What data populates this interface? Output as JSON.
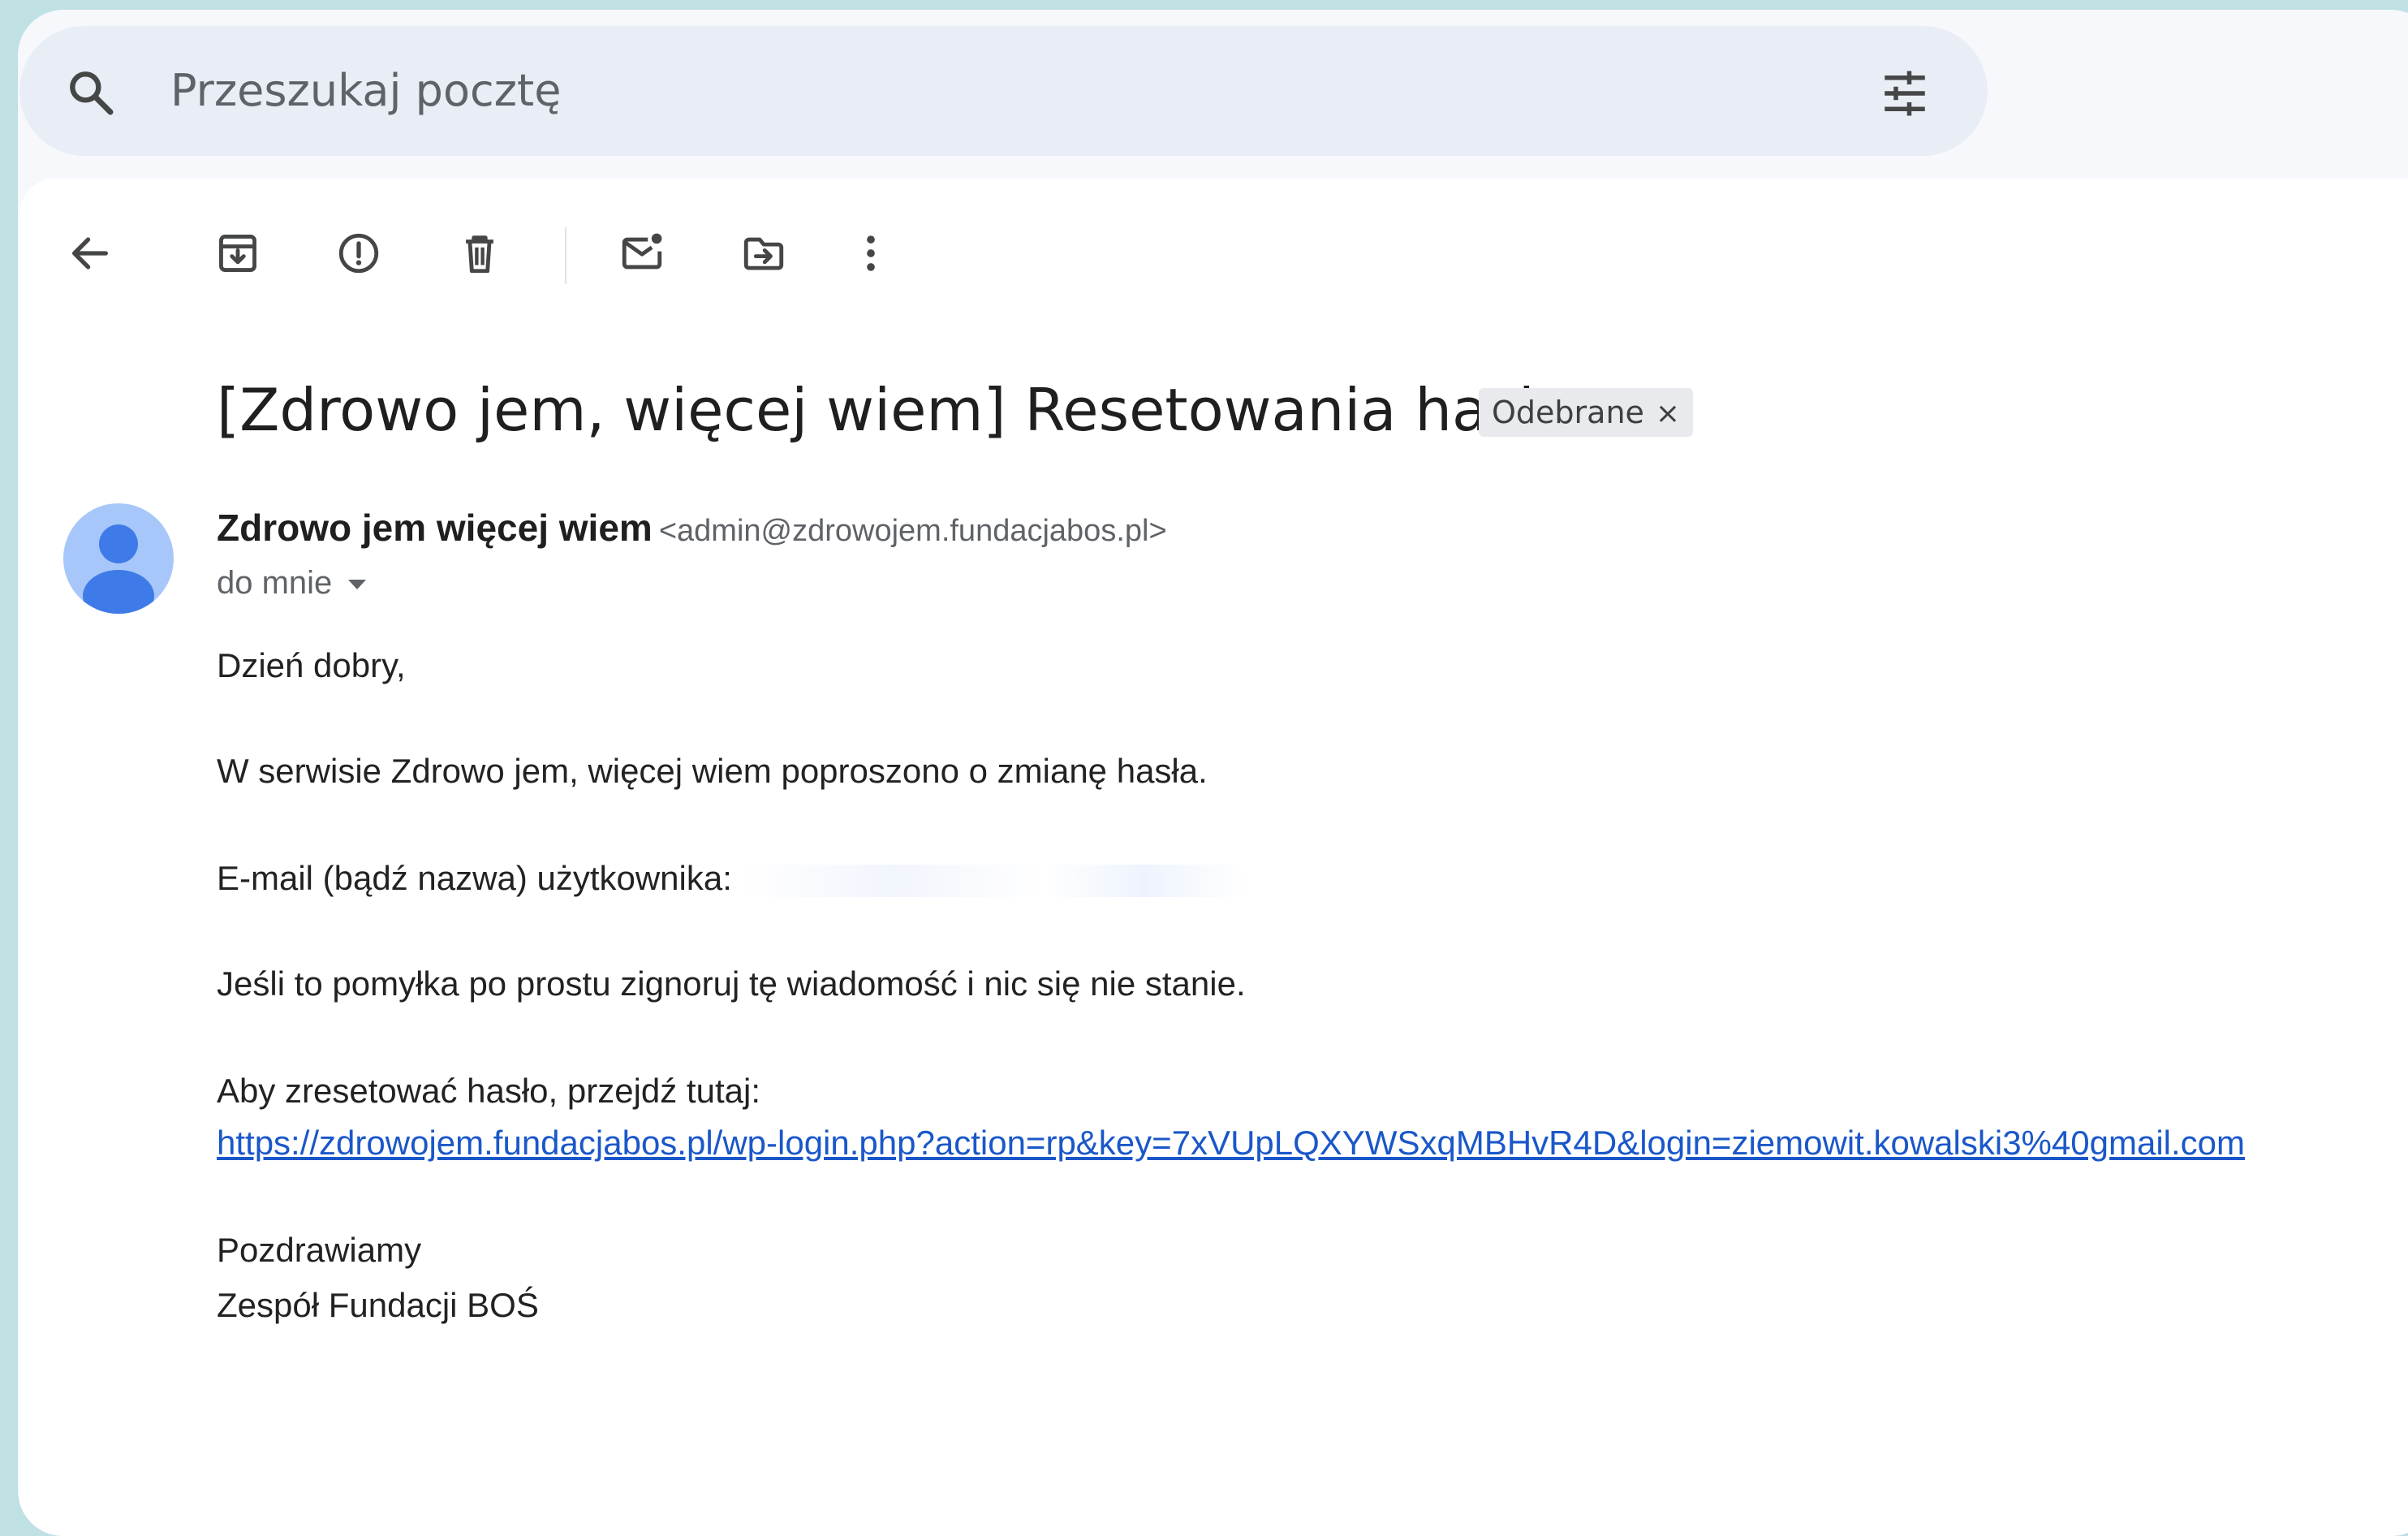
{
  "search": {
    "placeholder": "Przeszukaj pocztę"
  },
  "toolbar": {
    "icons": [
      "back-arrow-icon",
      "archive-icon",
      "report-spam-icon",
      "delete-icon",
      "mark-unread-icon",
      "move-to-icon",
      "more-vert-icon"
    ]
  },
  "email": {
    "subject": "[Zdrowo jem, więcej wiem] Resetowania hasła",
    "label": "Odebrane",
    "label_close": "×",
    "sender_name": "Zdrowo jem więcej wiem",
    "sender_email": "<admin@zdrowojem.fundacjabos.pl>",
    "recipient": "do mnie",
    "body": {
      "greeting": "Dzień dobry,",
      "line1": "W serwisie Zdrowo jem, więcej wiem poproszono o zmianę hasła.",
      "username_label": "E-mail (bądź nazwa) użytkownika:",
      "line3": "Jeśli to pomyłka po prostu zignoruj tę wiadomość i nic się nie stanie.",
      "reset_intro": "Aby zresetować hasło, przejdź tutaj:",
      "reset_link": "https://zdrowojem.fundacjabos.pl/wp-login.php?action=rp&key=7xVUpLQXYWSxqMBHvR4D&login=ziemowit.kowalski3%40gmail.com",
      "closing": "Pozdrawiamy",
      "signature": "Zespół Fundacji BOŚ"
    }
  },
  "colors": {
    "link": "#1a57c9",
    "avatar_bg": "#a7c7fa",
    "avatar_fg": "#3f7be8",
    "page_bg": "#bfe1e4"
  }
}
